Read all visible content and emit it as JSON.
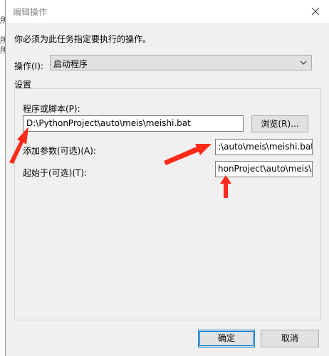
{
  "background": {
    "fragments": [
      "所",
      "所",
      "所"
    ]
  },
  "dialog": {
    "title": "编辑操作",
    "instruction": "你必须为此任务指定要执行的操作。",
    "action": {
      "label": "操作(I):",
      "value": "启动程序"
    },
    "settings": {
      "group_label": "设置",
      "program": {
        "label": "程序或脚本(P):",
        "value": "D:\\PythonProject\\auto\\meis\\meishi.bat"
      },
      "browse_label": "浏览(R)...",
      "arguments": {
        "label": "添加参数(可选)(A):",
        "value": ":\\auto\\meis\\meishi.bat"
      },
      "start_in": {
        "label": "起始于(可选)(T):",
        "value": "honProject\\auto\\meis\\"
      }
    },
    "ok_label": "确定",
    "cancel_label": "取消"
  },
  "colors": {
    "arrow": "#ff2a1a",
    "focus": "#0078d7",
    "background": "#f0f0f0"
  },
  "icons": {
    "close": "close-icon",
    "dropdown": "chevron-down-icon",
    "annotation": "red-arrow-icon"
  }
}
